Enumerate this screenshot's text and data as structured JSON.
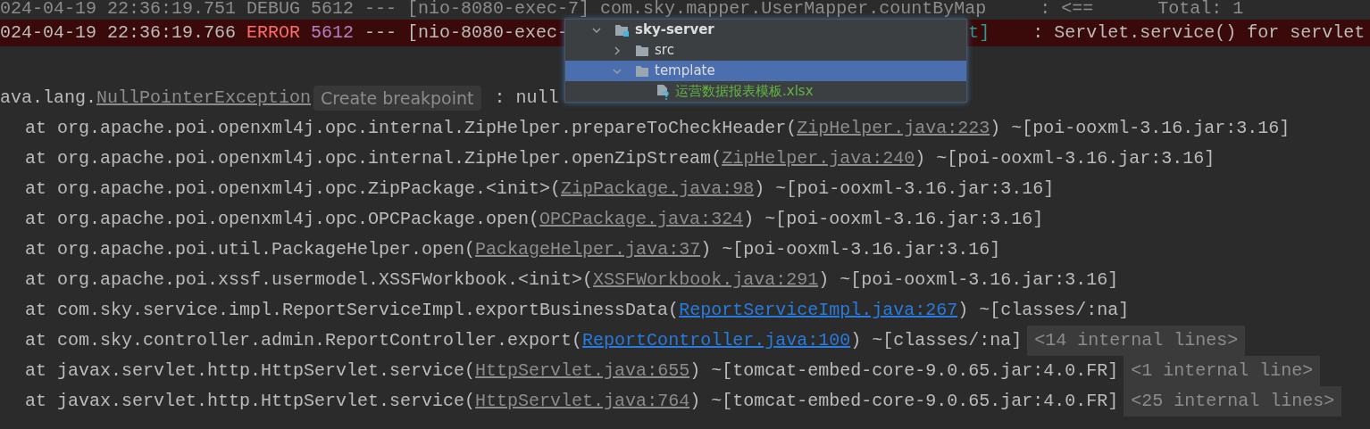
{
  "console": {
    "lines": [
      {
        "kind": "debug",
        "segments": [
          {
            "kind": "muted",
            "text": "024-04-19 22:36:19.751 DEBUG 5612 --- [nio-8080-exec-7] com.sky.mapper.UserMapper.countByMap     : <==      Total: 1"
          }
        ]
      },
      {
        "kind": "error",
        "segments": [
          {
            "kind": "plain",
            "text": "024-04-19 22:36:19.766 "
          },
          {
            "kind": "level",
            "text": "ERROR"
          },
          {
            "kind": "pid",
            "text": "5612"
          },
          {
            "kind": "plain",
            "text": " --- [nio-8080-exec-"
          },
          {
            "kind": "covered"
          },
          {
            "kind": "class_ref",
            "text": "t]"
          },
          {
            "kind": "plain",
            "text": "    : Servlet.service() for servlet"
          }
        ]
      },
      {
        "kind": "blank"
      },
      {
        "kind": "exception",
        "segments": [
          {
            "kind": "plain",
            "text": "ava.lang."
          },
          {
            "kind": "link_library",
            "text": "NullPointerException"
          },
          {
            "kind": "inlay",
            "text": "Create breakpoint"
          },
          {
            "kind": "plain",
            "text": " : null"
          }
        ]
      },
      {
        "kind": "frame",
        "segments": [
          {
            "kind": "plain",
            "text": "at org.apache.poi.openxml4j.opc.internal.ZipHelper.prepareToCheckHeader("
          },
          {
            "kind": "link_library",
            "text": "ZipHelper.java:223"
          },
          {
            "kind": "plain",
            "text": ") ~[poi-ooxml-3.16.jar:3.16]"
          }
        ]
      },
      {
        "kind": "frame",
        "segments": [
          {
            "kind": "plain",
            "text": "at org.apache.poi.openxml4j.opc.internal.ZipHelper.openZipStream("
          },
          {
            "kind": "link_library",
            "text": "ZipHelper.java:240"
          },
          {
            "kind": "plain",
            "text": ") ~[poi-ooxml-3.16.jar:3.16]"
          }
        ]
      },
      {
        "kind": "frame",
        "segments": [
          {
            "kind": "plain",
            "text": "at org.apache.poi.openxml4j.opc.ZipPackage.<init>("
          },
          {
            "kind": "link_library",
            "text": "ZipPackage.java:98"
          },
          {
            "kind": "plain",
            "text": ") ~[poi-ooxml-3.16.jar:3.16]"
          }
        ]
      },
      {
        "kind": "frame",
        "segments": [
          {
            "kind": "plain",
            "text": "at org.apache.poi.openxml4j.opc.OPCPackage.open("
          },
          {
            "kind": "link_library",
            "text": "OPCPackage.java:324"
          },
          {
            "kind": "plain",
            "text": ") ~[poi-ooxml-3.16.jar:3.16]"
          }
        ]
      },
      {
        "kind": "frame",
        "segments": [
          {
            "kind": "plain",
            "text": "at org.apache.poi.util.PackageHelper.open("
          },
          {
            "kind": "link_library",
            "text": "PackageHelper.java:37"
          },
          {
            "kind": "plain",
            "text": ") ~[poi-ooxml-3.16.jar:3.16]"
          }
        ]
      },
      {
        "kind": "frame",
        "segments": [
          {
            "kind": "plain",
            "text": "at org.apache.poi.xssf.usermodel.XSSFWorkbook.<init>("
          },
          {
            "kind": "link_library",
            "text": "XSSFWorkbook.java:291"
          },
          {
            "kind": "plain",
            "text": ") ~[poi-ooxml-3.16.jar:3.16]"
          }
        ]
      },
      {
        "kind": "frame",
        "segments": [
          {
            "kind": "plain",
            "text": "at com.sky.service.impl.ReportServiceImpl.exportBusinessData("
          },
          {
            "kind": "link_project",
            "text": "ReportServiceImpl.java:267"
          },
          {
            "kind": "plain",
            "text": ") ~[classes/:na]"
          }
        ]
      },
      {
        "kind": "frame",
        "segments": [
          {
            "kind": "plain",
            "text": "at com.sky.controller.admin.ReportController.export("
          },
          {
            "kind": "link_project",
            "text": "ReportController.java:100"
          },
          {
            "kind": "plain",
            "text": ") ~[classes/:na]"
          },
          {
            "kind": "folded",
            "text": "<14 internal lines>"
          }
        ]
      },
      {
        "kind": "frame",
        "segments": [
          {
            "kind": "plain",
            "text": "at javax.servlet.http.HttpServlet.service("
          },
          {
            "kind": "link_library",
            "text": "HttpServlet.java:655"
          },
          {
            "kind": "plain",
            "text": ") ~[tomcat-embed-core-9.0.65.jar:4.0.FR]"
          },
          {
            "kind": "folded",
            "text": "<1 internal line>"
          }
        ]
      },
      {
        "kind": "frame",
        "segments": [
          {
            "kind": "plain",
            "text": "at javax.servlet.http.HttpServlet.service("
          },
          {
            "kind": "link_library",
            "text": "HttpServlet.java:764"
          },
          {
            "kind": "plain",
            "text": ") ~[tomcat-embed-core-9.0.65.jar:4.0.FR]"
          },
          {
            "kind": "folded",
            "text": "<25 internal lines>"
          }
        ]
      }
    ]
  },
  "project_popup": {
    "tree": [
      {
        "kind": "module",
        "label": "sky-server",
        "expanded": true,
        "selected": false,
        "children": [
          {
            "kind": "folder",
            "label": "src",
            "expanded": false,
            "selected": false
          },
          {
            "kind": "folder",
            "label": "template",
            "expanded": true,
            "selected": true,
            "children": [
              {
                "kind": "file",
                "label": "运营数据报表模板.xlsx",
                "selected": false
              }
            ]
          }
        ]
      }
    ]
  }
}
